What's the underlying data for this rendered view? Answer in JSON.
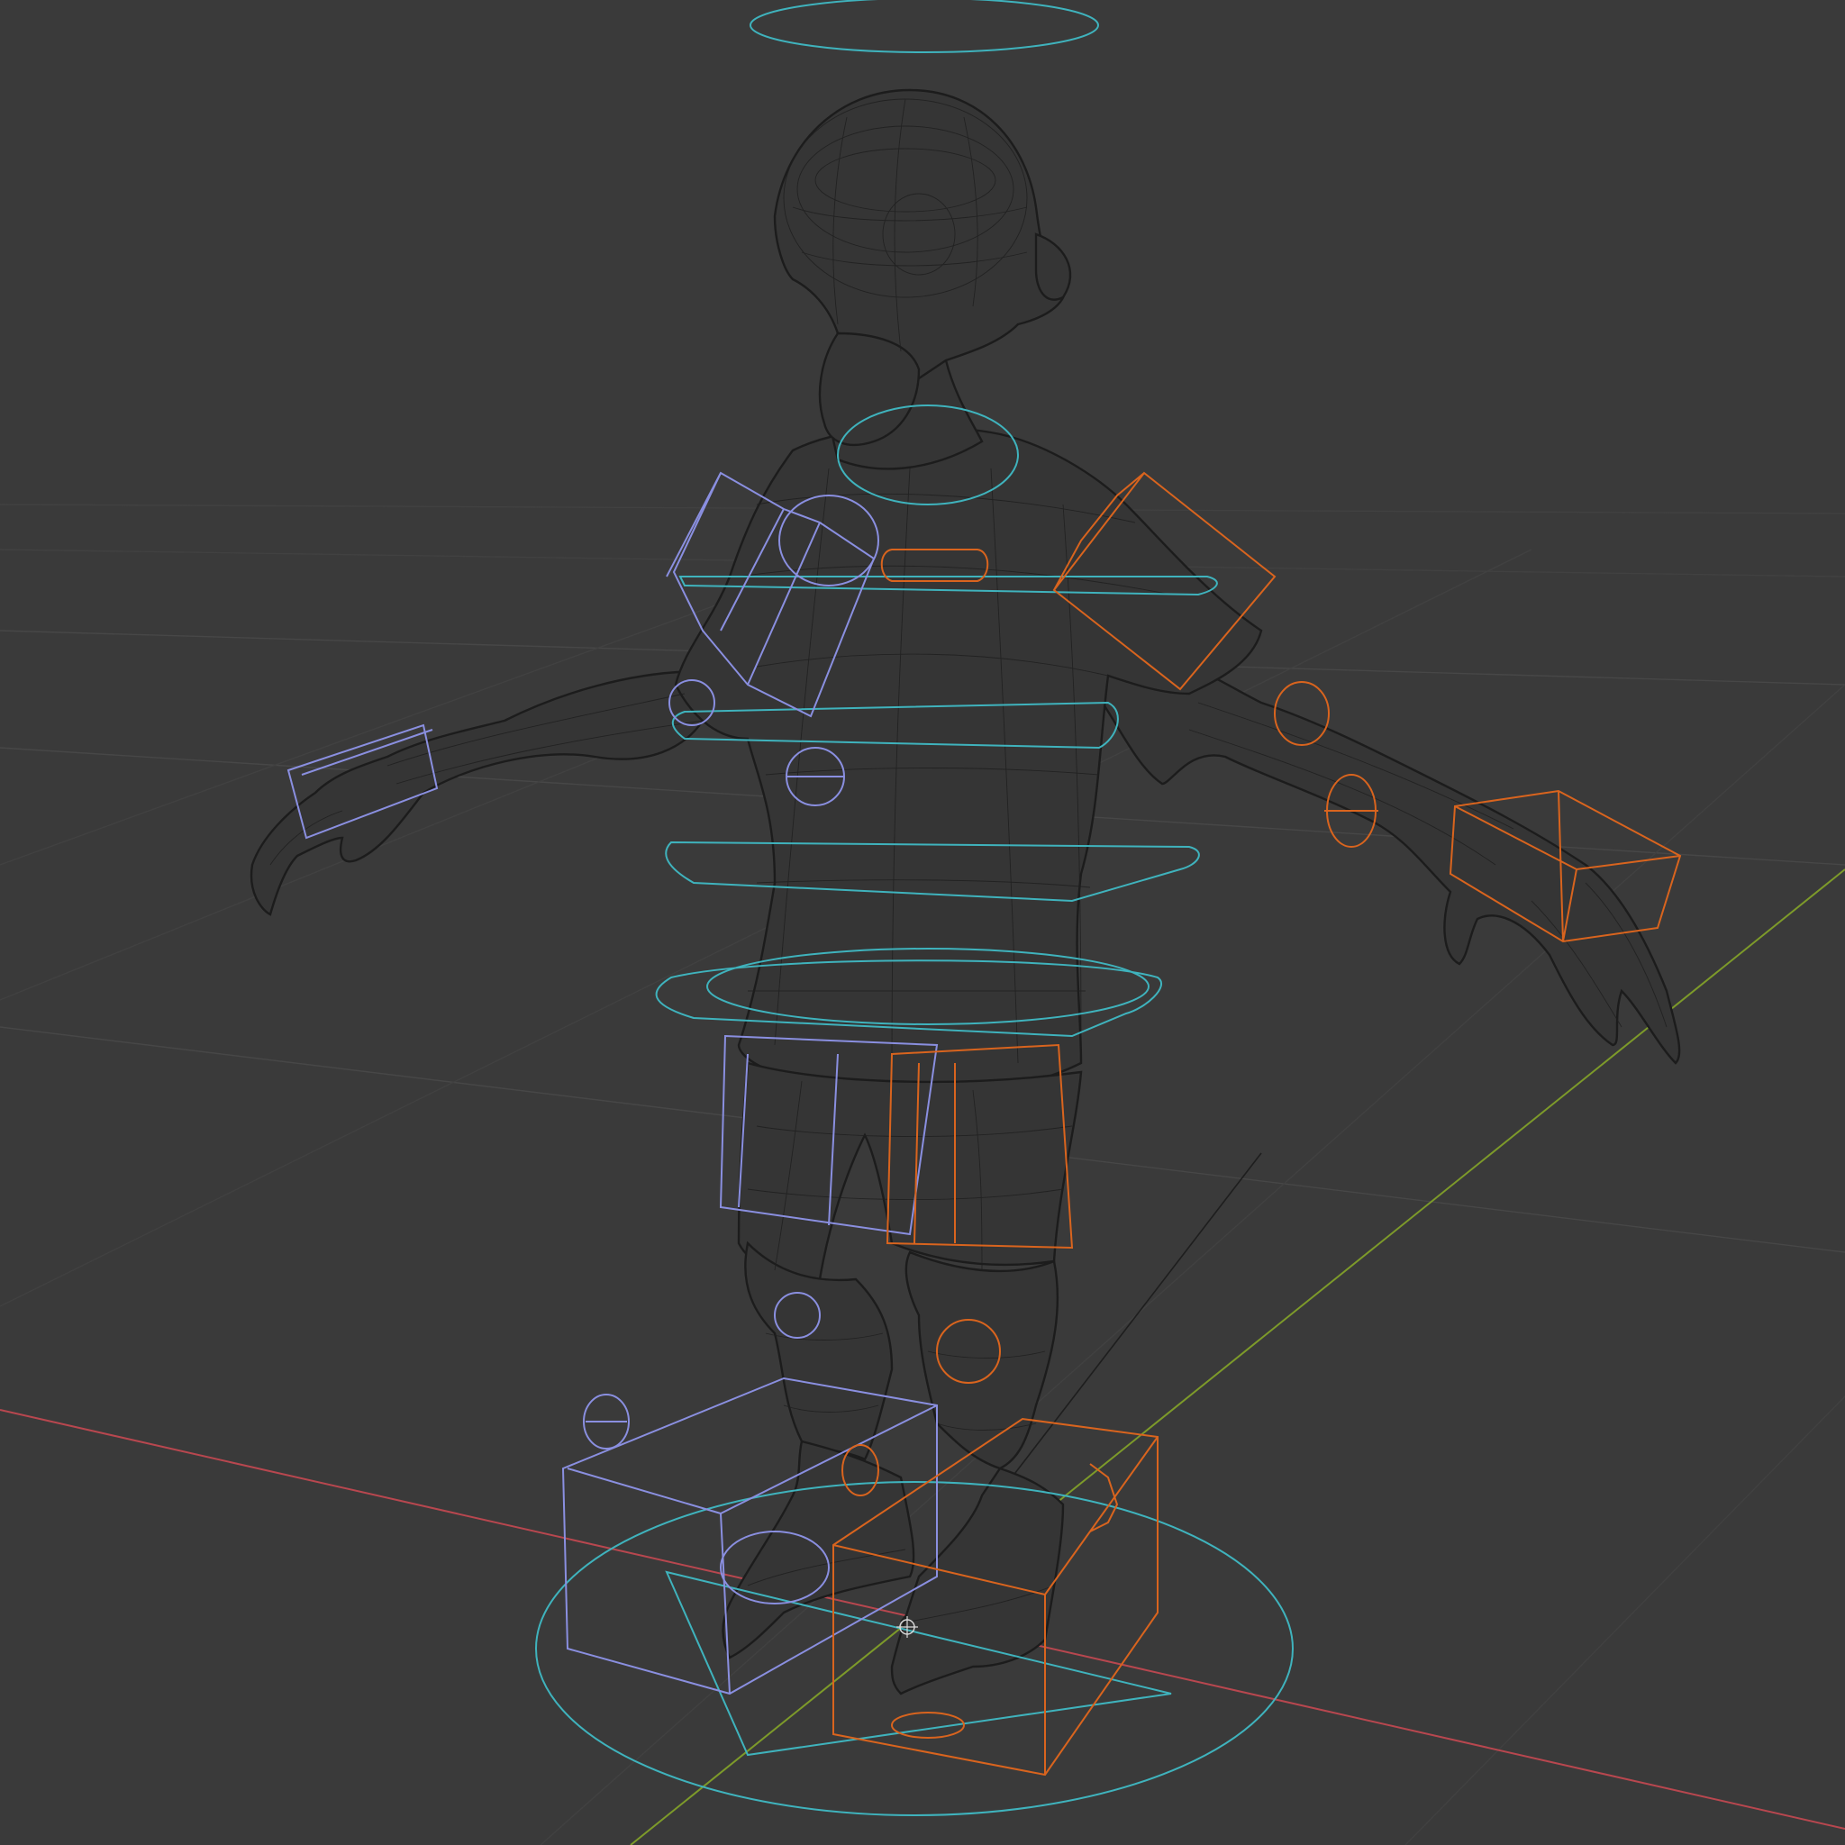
{
  "viewport": {
    "mode": "wireframe",
    "background_color": "#3a3a3a",
    "grid_color": "#474747",
    "axes": {
      "x_color": "#b8474f",
      "y_color": "#7d9a2a",
      "z_color": "#1e1e1e"
    },
    "scene_objects": {
      "character_mesh": {
        "icon": "character-mesh",
        "wire_color": "#1f1f1f"
      },
      "rig_controls": {
        "center_color": "#3fb3bd",
        "left_side_color": "#8a8fe0",
        "right_side_color": "#d9641e"
      },
      "origin_cursor": {
        "icon": "3d-cursor-icon"
      }
    }
  }
}
